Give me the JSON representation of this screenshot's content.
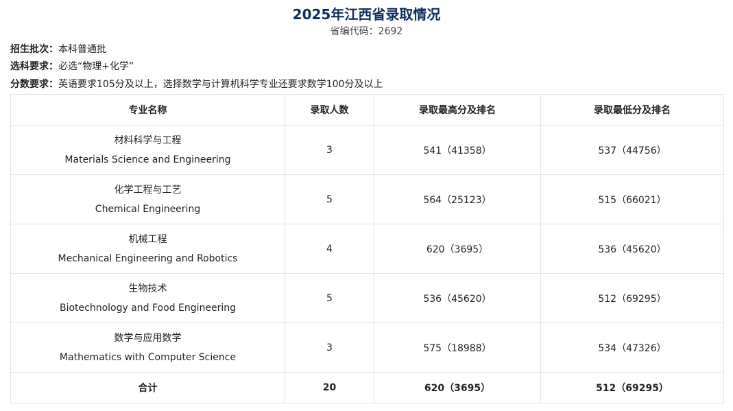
{
  "header": {
    "title": "2025年江西省录取情况",
    "subtitle": "省编代码：2692",
    "title_color": "#0d2d5c"
  },
  "info": {
    "batch_label": "招生批次：",
    "batch_value": "本科普通批",
    "subject_label": "选科要求：",
    "subject_value": "必选“物理+化学”",
    "score_label": "分数要求：",
    "score_value": "英语要求105分及以上，选择数学与计算机科学专业还要求数学100分及以上"
  },
  "table": {
    "columns": [
      "专业名称",
      "录取人数",
      "录取最高分及排名",
      "录取最低分及排名"
    ],
    "rows": [
      {
        "major_cn": "材料科学与工程",
        "major_en": "Materials Science and Engineering",
        "count": "3",
        "max": "541（41358）",
        "min": "537（44756）"
      },
      {
        "major_cn": "化学工程与工艺",
        "major_en": "Chemical Engineering",
        "count": "5",
        "max": "564（25123）",
        "min": "515（66021）"
      },
      {
        "major_cn": "机械工程",
        "major_en": "Mechanical Engineering and Robotics",
        "count": "4",
        "max": "620（3695）",
        "min": "536（45620）"
      },
      {
        "major_cn": "生物技术",
        "major_en": "Biotechnology and Food Engineering",
        "count": "5",
        "max": "536（45620）",
        "min": "512（69295）"
      },
      {
        "major_cn": "数学与应用数学",
        "major_en": "Mathematics with Computer Science",
        "count": "3",
        "max": "575（18988）",
        "min": "534（47326）"
      }
    ],
    "total": {
      "label": "合计",
      "count": "20",
      "max": "620（3695）",
      "min": "512（69295）"
    }
  }
}
